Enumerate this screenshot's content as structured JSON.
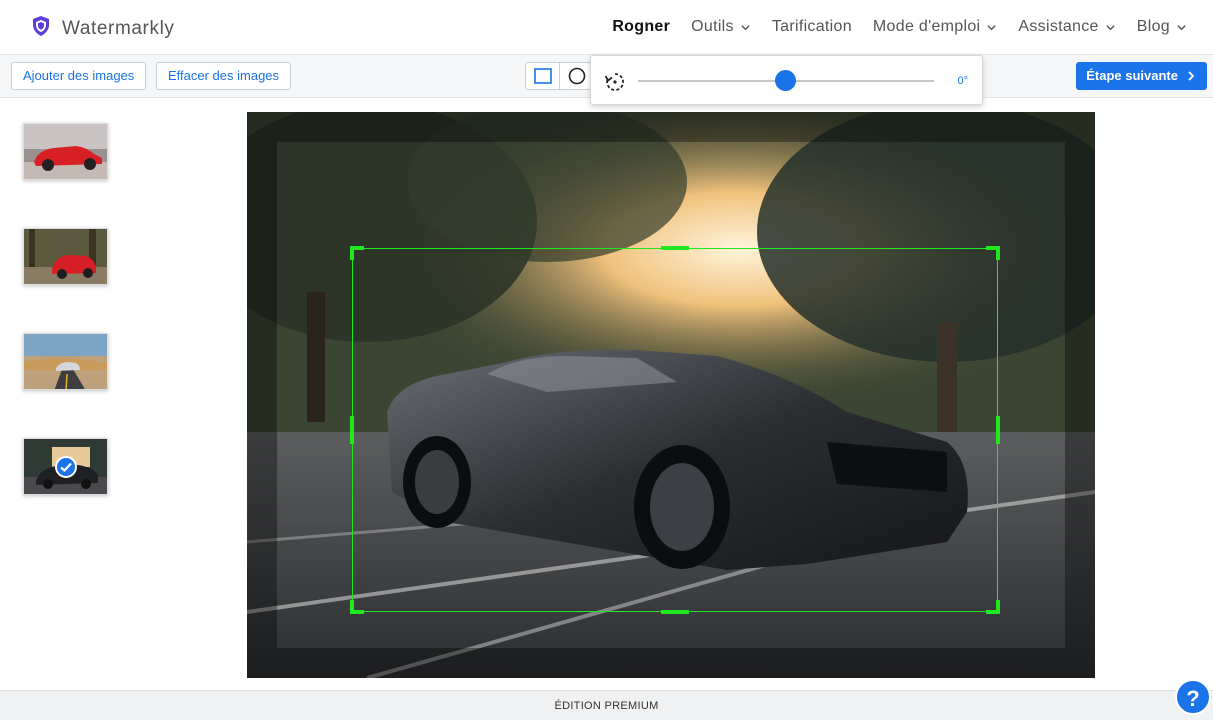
{
  "brand": {
    "name": "Watermarkly",
    "logo_icon": "shield-logo-icon"
  },
  "nav": [
    {
      "label": "Rogner",
      "active": true,
      "dropdown": false
    },
    {
      "label": "Outils",
      "active": false,
      "dropdown": true
    },
    {
      "label": "Tarification",
      "active": false,
      "dropdown": false
    },
    {
      "label": "Mode d'emploi",
      "active": false,
      "dropdown": true
    },
    {
      "label": "Assistance",
      "active": false,
      "dropdown": true
    },
    {
      "label": "Blog",
      "active": false,
      "dropdown": true
    }
  ],
  "toolbar": {
    "add_images": "Ajouter des images",
    "clear_images": "Effacer des images",
    "shapes": [
      "rectangle-shape-icon",
      "circle-shape-icon"
    ],
    "next_step": "Étape suivante"
  },
  "rotation": {
    "icon": "rotate-icon",
    "value_label": "0°",
    "value": 0
  },
  "thumbnails": [
    {
      "name": "red-classic-car",
      "selected": false
    },
    {
      "name": "red-hatchback-forest",
      "selected": false
    },
    {
      "name": "car-on-road",
      "selected": false
    },
    {
      "name": "black-mustang",
      "selected": true
    }
  ],
  "footer": {
    "text": "ÉDITION PREMIUM"
  },
  "help": {
    "label": "?"
  },
  "colors": {
    "accent": "#1a73e8",
    "crop": "#1fe81f"
  }
}
